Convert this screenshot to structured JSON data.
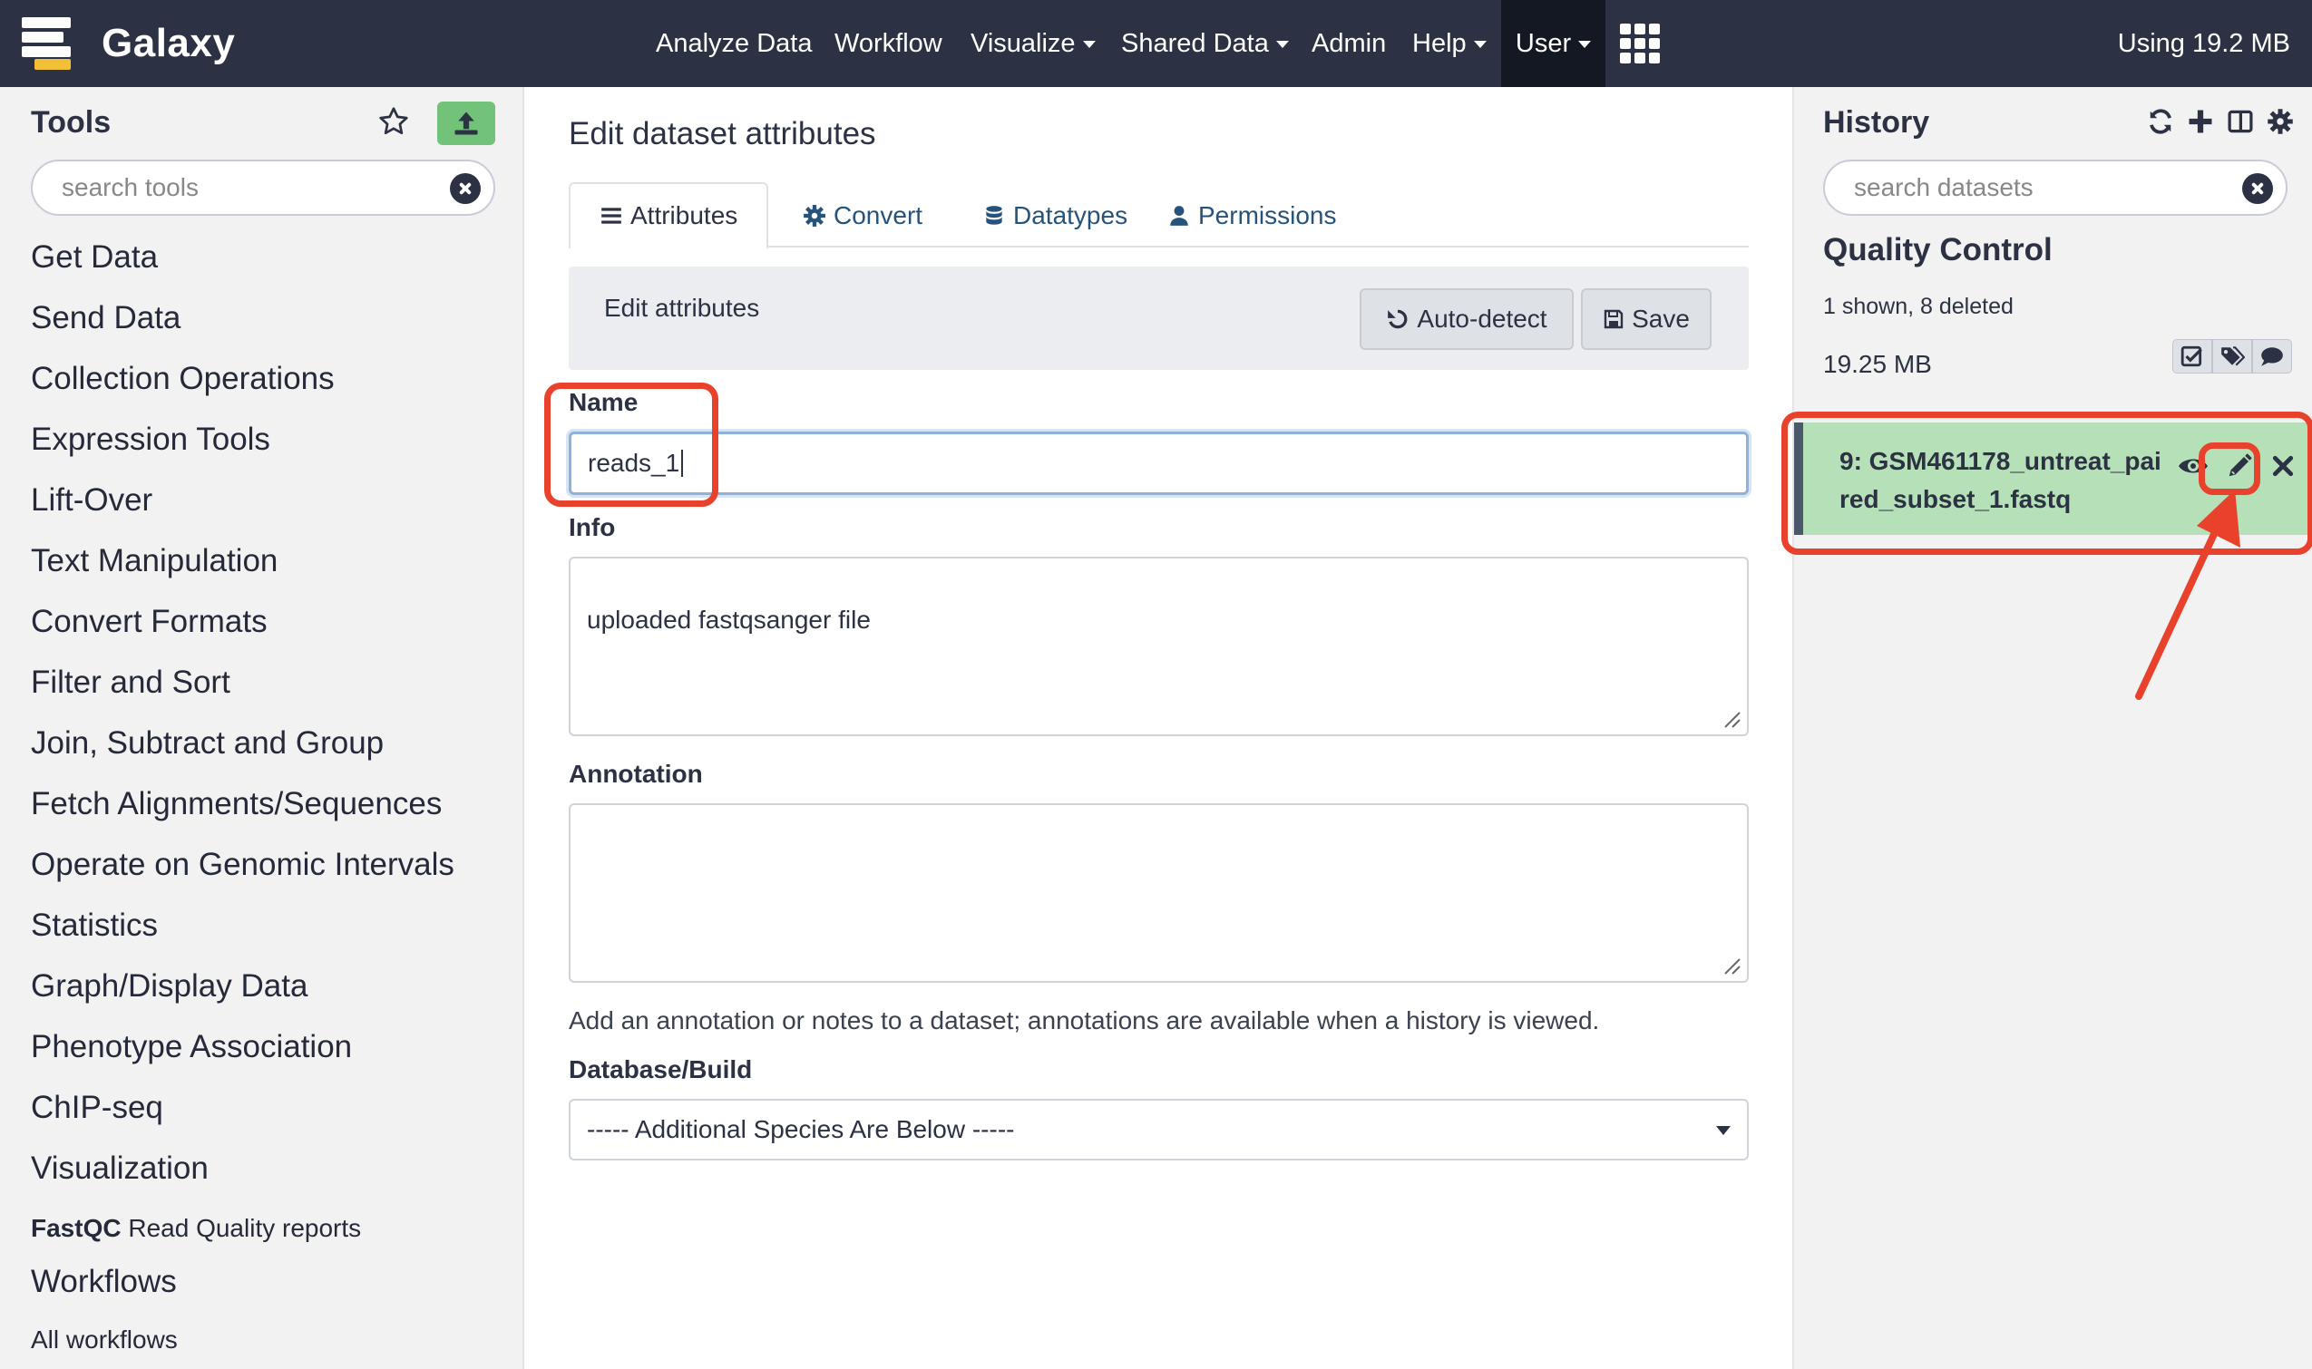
{
  "masthead": {
    "brand": "Galaxy",
    "nav": [
      "Analyze Data",
      "Workflow",
      "Visualize",
      "Shared Data",
      "Admin",
      "Help",
      "User"
    ],
    "quota": "Using 19.2 MB"
  },
  "tool_panel": {
    "title": "Tools",
    "search_placeholder": "search tools",
    "sections": [
      "Get Data",
      "Send Data",
      "Collection Operations",
      "Expression Tools",
      "Lift-Over",
      "Text Manipulation",
      "Convert Formats",
      "Filter and Sort",
      "Join, Subtract and Group",
      "Fetch Alignments/Sequences",
      "Operate on Genomic Intervals",
      "Statistics",
      "Graph/Display Data",
      "Phenotype Association",
      "ChIP-seq",
      "Visualization"
    ],
    "fastqc_name": "FastQC",
    "fastqc_desc": " Read Quality reports",
    "workflows_title": "Workflows",
    "all_workflows": "All workflows"
  },
  "center": {
    "title": "Edit dataset attributes",
    "tabs": [
      "Attributes",
      "Convert",
      "Datatypes",
      "Permissions"
    ],
    "card_title": "Edit attributes",
    "autodetect_label": "Auto-detect",
    "save_label": "Save",
    "name_label": "Name",
    "name_value": "reads_1",
    "info_label": "Info",
    "info_value": "uploaded fastqsanger file",
    "annotation_label": "Annotation",
    "annotation_value": "",
    "annotation_help": "Add an annotation or notes to a dataset; annotations are available when a history is viewed.",
    "dbkey_label": "Database/Build",
    "dbkey_value": "----- Additional Species Are Below -----"
  },
  "history": {
    "title": "History",
    "search_placeholder": "search datasets",
    "name": "Quality Control",
    "counts": "1 shown, 8 deleted",
    "size": "19.25 MB",
    "dataset": {
      "title": "9: GSM461178_untreat_paired_subset_1.fastq",
      "state_color": "#b6e1b8"
    }
  },
  "colors": {
    "masthead": "#2c3143",
    "panel_bg": "#f2f2f2",
    "upload_button": "#73c279",
    "annotation_red": "#e8412c",
    "link_blue": "#25537b"
  }
}
